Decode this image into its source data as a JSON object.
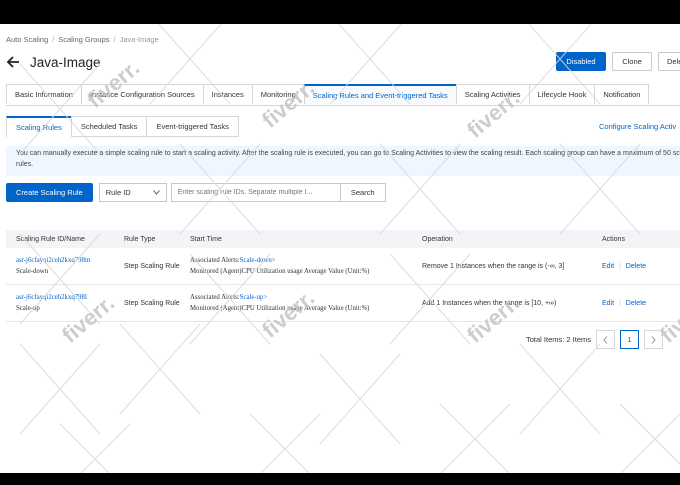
{
  "breadcrumb": [
    "Auto Scaling",
    "Scaling Groups",
    "Java-Image"
  ],
  "page_title": "Java-Image",
  "header_buttons": {
    "disabled": "Disabled",
    "clone": "Clone",
    "delete": "Dele"
  },
  "tabs": [
    "Basic Information",
    "Instance Configuration Sources",
    "Instances",
    "Monitoring",
    "Scaling Rules and Event-triggered Tasks",
    "Scaling Activities",
    "Lifecycle Hook",
    "Notification"
  ],
  "subtabs": [
    "Scaling Rules",
    "Scheduled Tasks",
    "Event-triggered Tasks"
  ],
  "config_link": "Configure Scaling Activ",
  "notice": "You can manually execute a simple scaling rule to start a scaling activity. After the scaling rule is executed, you can go to Scaling Activities to view the scaling result. Each scaling group can have a maximum of 50 scaling rules.",
  "toolbar": {
    "create": "Create Scaling Rule",
    "select": "Rule ID",
    "search_placeholder": "Enter scaling rule IDs. Separate multiple I...",
    "search": "Search"
  },
  "columns": [
    "Scaling Rule ID/Name",
    "Rule Type",
    "Start Time",
    "Operation",
    "Actions"
  ],
  "rows": [
    {
      "id": "asr-j6cfayqi2ceh2kxq798m",
      "name": "Scale-down",
      "type": "Step Scaling Rule",
      "alert_prefix": "Associated Alerts:",
      "alert_link": "Scale-down>",
      "metric": "Monitored (Agent)CPU Utilization usage Average Value (Unit:%)",
      "operation": "Remove 1 Instances when the range is (-∞, 3]",
      "edit": "Edit",
      "delete": "Delete"
    },
    {
      "id": "asr-j6cfayqi2ceh2kxq798l",
      "name": "Scale-up",
      "type": "Step Scaling Rule",
      "alert_prefix": "Associated Alerts:",
      "alert_link": "Scale-up>",
      "metric": "Monitored (Agent)CPU Utilization usage Average Value (Unit:%)",
      "operation": "Add 1 Instances when the range is [10, +∞)",
      "edit": "Edit",
      "delete": "Delete"
    }
  ],
  "pagination": {
    "total": "Total Items: 2 Items",
    "current": "1"
  },
  "watermark": "fiverr."
}
